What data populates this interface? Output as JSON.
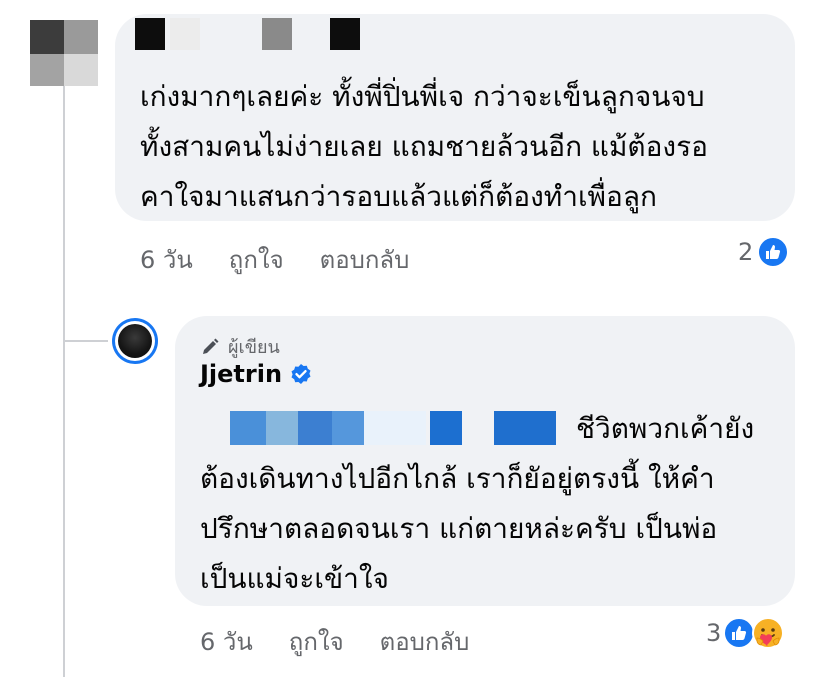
{
  "comment": {
    "text": "เก่งมากๆเลยค่ะ ทั้งพี่ปิ่นพี่เจ กว่าจะเข็นลูกจนจบ\nทั้งสามคนไม่ง่ายเลย แถมชายล้วนอีก แม้ต้องรอ\nคาใจมาแสนกว่ารอบแล้วแต่ก็ต้องทำเพื่อลูก",
    "time": "6 วัน",
    "like_label": "ถูกใจ",
    "reply_label": "ตอบกลับ",
    "reaction_count": "2",
    "reactions": [
      "like-icon"
    ]
  },
  "reply": {
    "badge": "ผู้เขียน",
    "author": "Jjetrin",
    "verified": true,
    "text_line_1": "ชีวิตพวกเค้ายัง",
    "text_rest": "ต้องเดินทางไปอีกไกล้ เราก็ยัอยู่ตรงนี้ ให้คำ\nปรึกษาตลอดจนเรา แก่ตายหล่ะครับ เป็นพ่อ\nเป็นแม่จะเข้าใจ",
    "time": "6 วัน",
    "like_label": "ถูกใจ",
    "reply_label": "ตอบกลับ",
    "reaction_count": "3",
    "reactions": [
      "like-icon",
      "care-icon"
    ]
  },
  "colors": {
    "accent": "#1877f2",
    "bubble": "#f0f2f5",
    "muted_text": "#65676b",
    "care": "#f7b125"
  }
}
